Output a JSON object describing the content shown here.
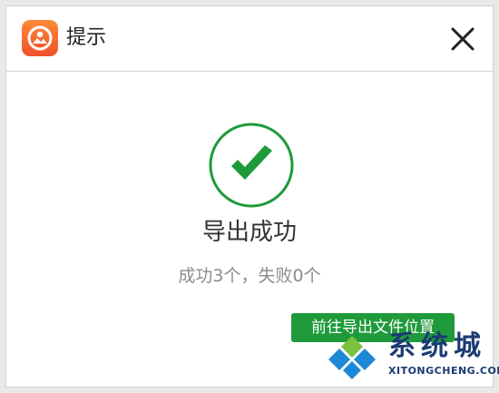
{
  "window": {
    "title": "提示",
    "app_icon": "photo-app-icon",
    "close_icon": "close-icon"
  },
  "result": {
    "status_icon": "checkmark-circle-icon",
    "title": "导出成功",
    "detail": "成功3个，失败0个"
  },
  "actions": {
    "open_folder_label": "前往导出文件位置"
  },
  "watermark": {
    "name": "系统城",
    "url": "XITONGCHENG.COM"
  },
  "colors": {
    "success_green": "#1f9a3a",
    "app_icon_orange": "#f0502a",
    "watermark_blue": "#1b3a73"
  }
}
